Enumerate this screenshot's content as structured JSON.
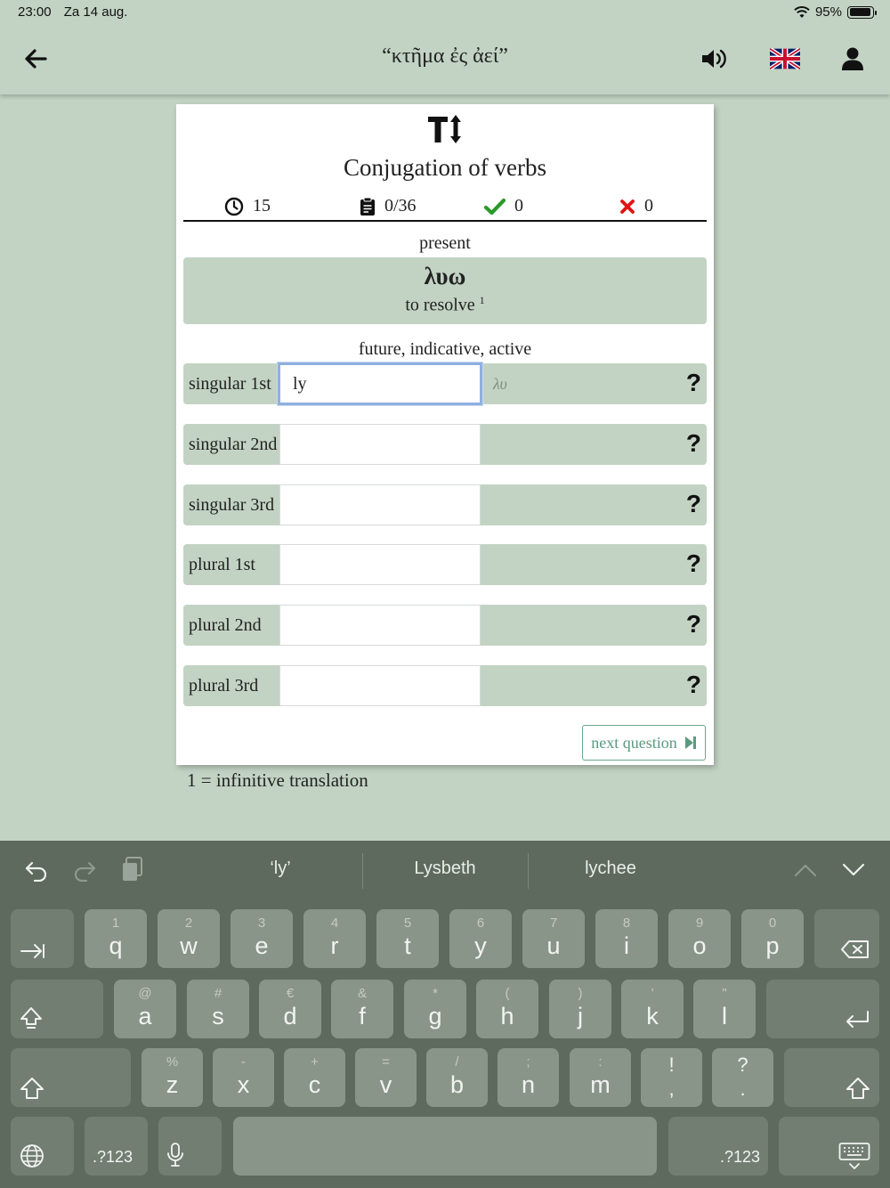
{
  "status_bar": {
    "time": "23:00",
    "date": "Za 14 aug.",
    "battery": "95%",
    "battery_level": 0.95
  },
  "nav": {
    "title": "“κτῆμα ἐς ἀεί”",
    "icons": [
      "arrow-left-icon",
      "speaker-icon",
      "uk-flag-icon",
      "user-icon"
    ]
  },
  "card": {
    "title": "Conjugation of verbs",
    "stats": {
      "timer": "15",
      "progress": "0/36",
      "correct": "0",
      "wrong": "0"
    },
    "tense_label": "present",
    "verb": "λυω",
    "translation": "to resolve",
    "translation_marker": "1",
    "form_label": "future, indicative, active",
    "rows": [
      {
        "label": "singular 1st",
        "value": "ly",
        "hint": "λυ",
        "help": "?"
      },
      {
        "label": "singular 2nd",
        "value": "",
        "hint": "",
        "help": "?"
      },
      {
        "label": "singular 3rd",
        "value": "",
        "hint": "",
        "help": "?"
      },
      {
        "label": "plural 1st",
        "value": "",
        "hint": "",
        "help": "?"
      },
      {
        "label": "plural 2nd",
        "value": "",
        "hint": "",
        "help": "?"
      },
      {
        "label": "plural 3rd",
        "value": "",
        "hint": "",
        "help": "?"
      }
    ],
    "next_button": "next question"
  },
  "footnote": "1 = infinitive translation",
  "keyboard": {
    "suggestions": [
      "‘ly’",
      "Lysbeth",
      "lychee"
    ],
    "row1": [
      {
        "key": "q",
        "alt": "1"
      },
      {
        "key": "w",
        "alt": "2"
      },
      {
        "key": "e",
        "alt": "3"
      },
      {
        "key": "r",
        "alt": "4"
      },
      {
        "key": "t",
        "alt": "5"
      },
      {
        "key": "y",
        "alt": "6"
      },
      {
        "key": "u",
        "alt": "7"
      },
      {
        "key": "i",
        "alt": "8"
      },
      {
        "key": "o",
        "alt": "9"
      },
      {
        "key": "p",
        "alt": "0"
      }
    ],
    "row2": [
      {
        "key": "a",
        "alt": "@"
      },
      {
        "key": "s",
        "alt": "#"
      },
      {
        "key": "d",
        "alt": "€"
      },
      {
        "key": "f",
        "alt": "&"
      },
      {
        "key": "g",
        "alt": "*"
      },
      {
        "key": "h",
        "alt": "("
      },
      {
        "key": "j",
        "alt": ")"
      },
      {
        "key": "k",
        "alt": "’"
      },
      {
        "key": "l",
        "alt": "\""
      }
    ],
    "row3": [
      {
        "key": "z",
        "alt": "%"
      },
      {
        "key": "x",
        "alt": "-"
      },
      {
        "key": "c",
        "alt": "+"
      },
      {
        "key": "v",
        "alt": "="
      },
      {
        "key": "b",
        "alt": "/"
      },
      {
        "key": "n",
        "alt": ";"
      },
      {
        "key": "m",
        "alt": ":"
      },
      {
        "key": ",",
        "alt": "!"
      },
      {
        "key": ".",
        "alt": "?"
      }
    ],
    "numbers_label": ".?123"
  }
}
